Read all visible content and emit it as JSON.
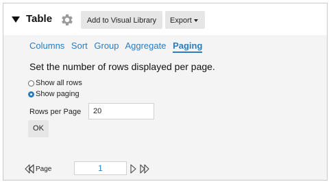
{
  "header": {
    "title": "Table",
    "add_button": "Add to Visual Library",
    "export_button": "Export"
  },
  "tabs": [
    {
      "label": "Columns",
      "active": false
    },
    {
      "label": "Sort",
      "active": false
    },
    {
      "label": "Group",
      "active": false
    },
    {
      "label": "Aggregate",
      "active": false
    },
    {
      "label": "Paging",
      "active": true
    }
  ],
  "paging": {
    "heading": "Set the number of rows displayed per page.",
    "option_all": "Show all rows",
    "option_paging": "Show paging",
    "selected_option": "Show paging",
    "rows_label": "Rows per Page",
    "rows_value": "20",
    "ok_label": "OK"
  },
  "pager": {
    "page_label": "Page",
    "page_value": "1"
  },
  "colors": {
    "accent": "#2a7bc0",
    "panel_bg": "#f4f4f4",
    "button_bg": "#e6e6e6"
  }
}
